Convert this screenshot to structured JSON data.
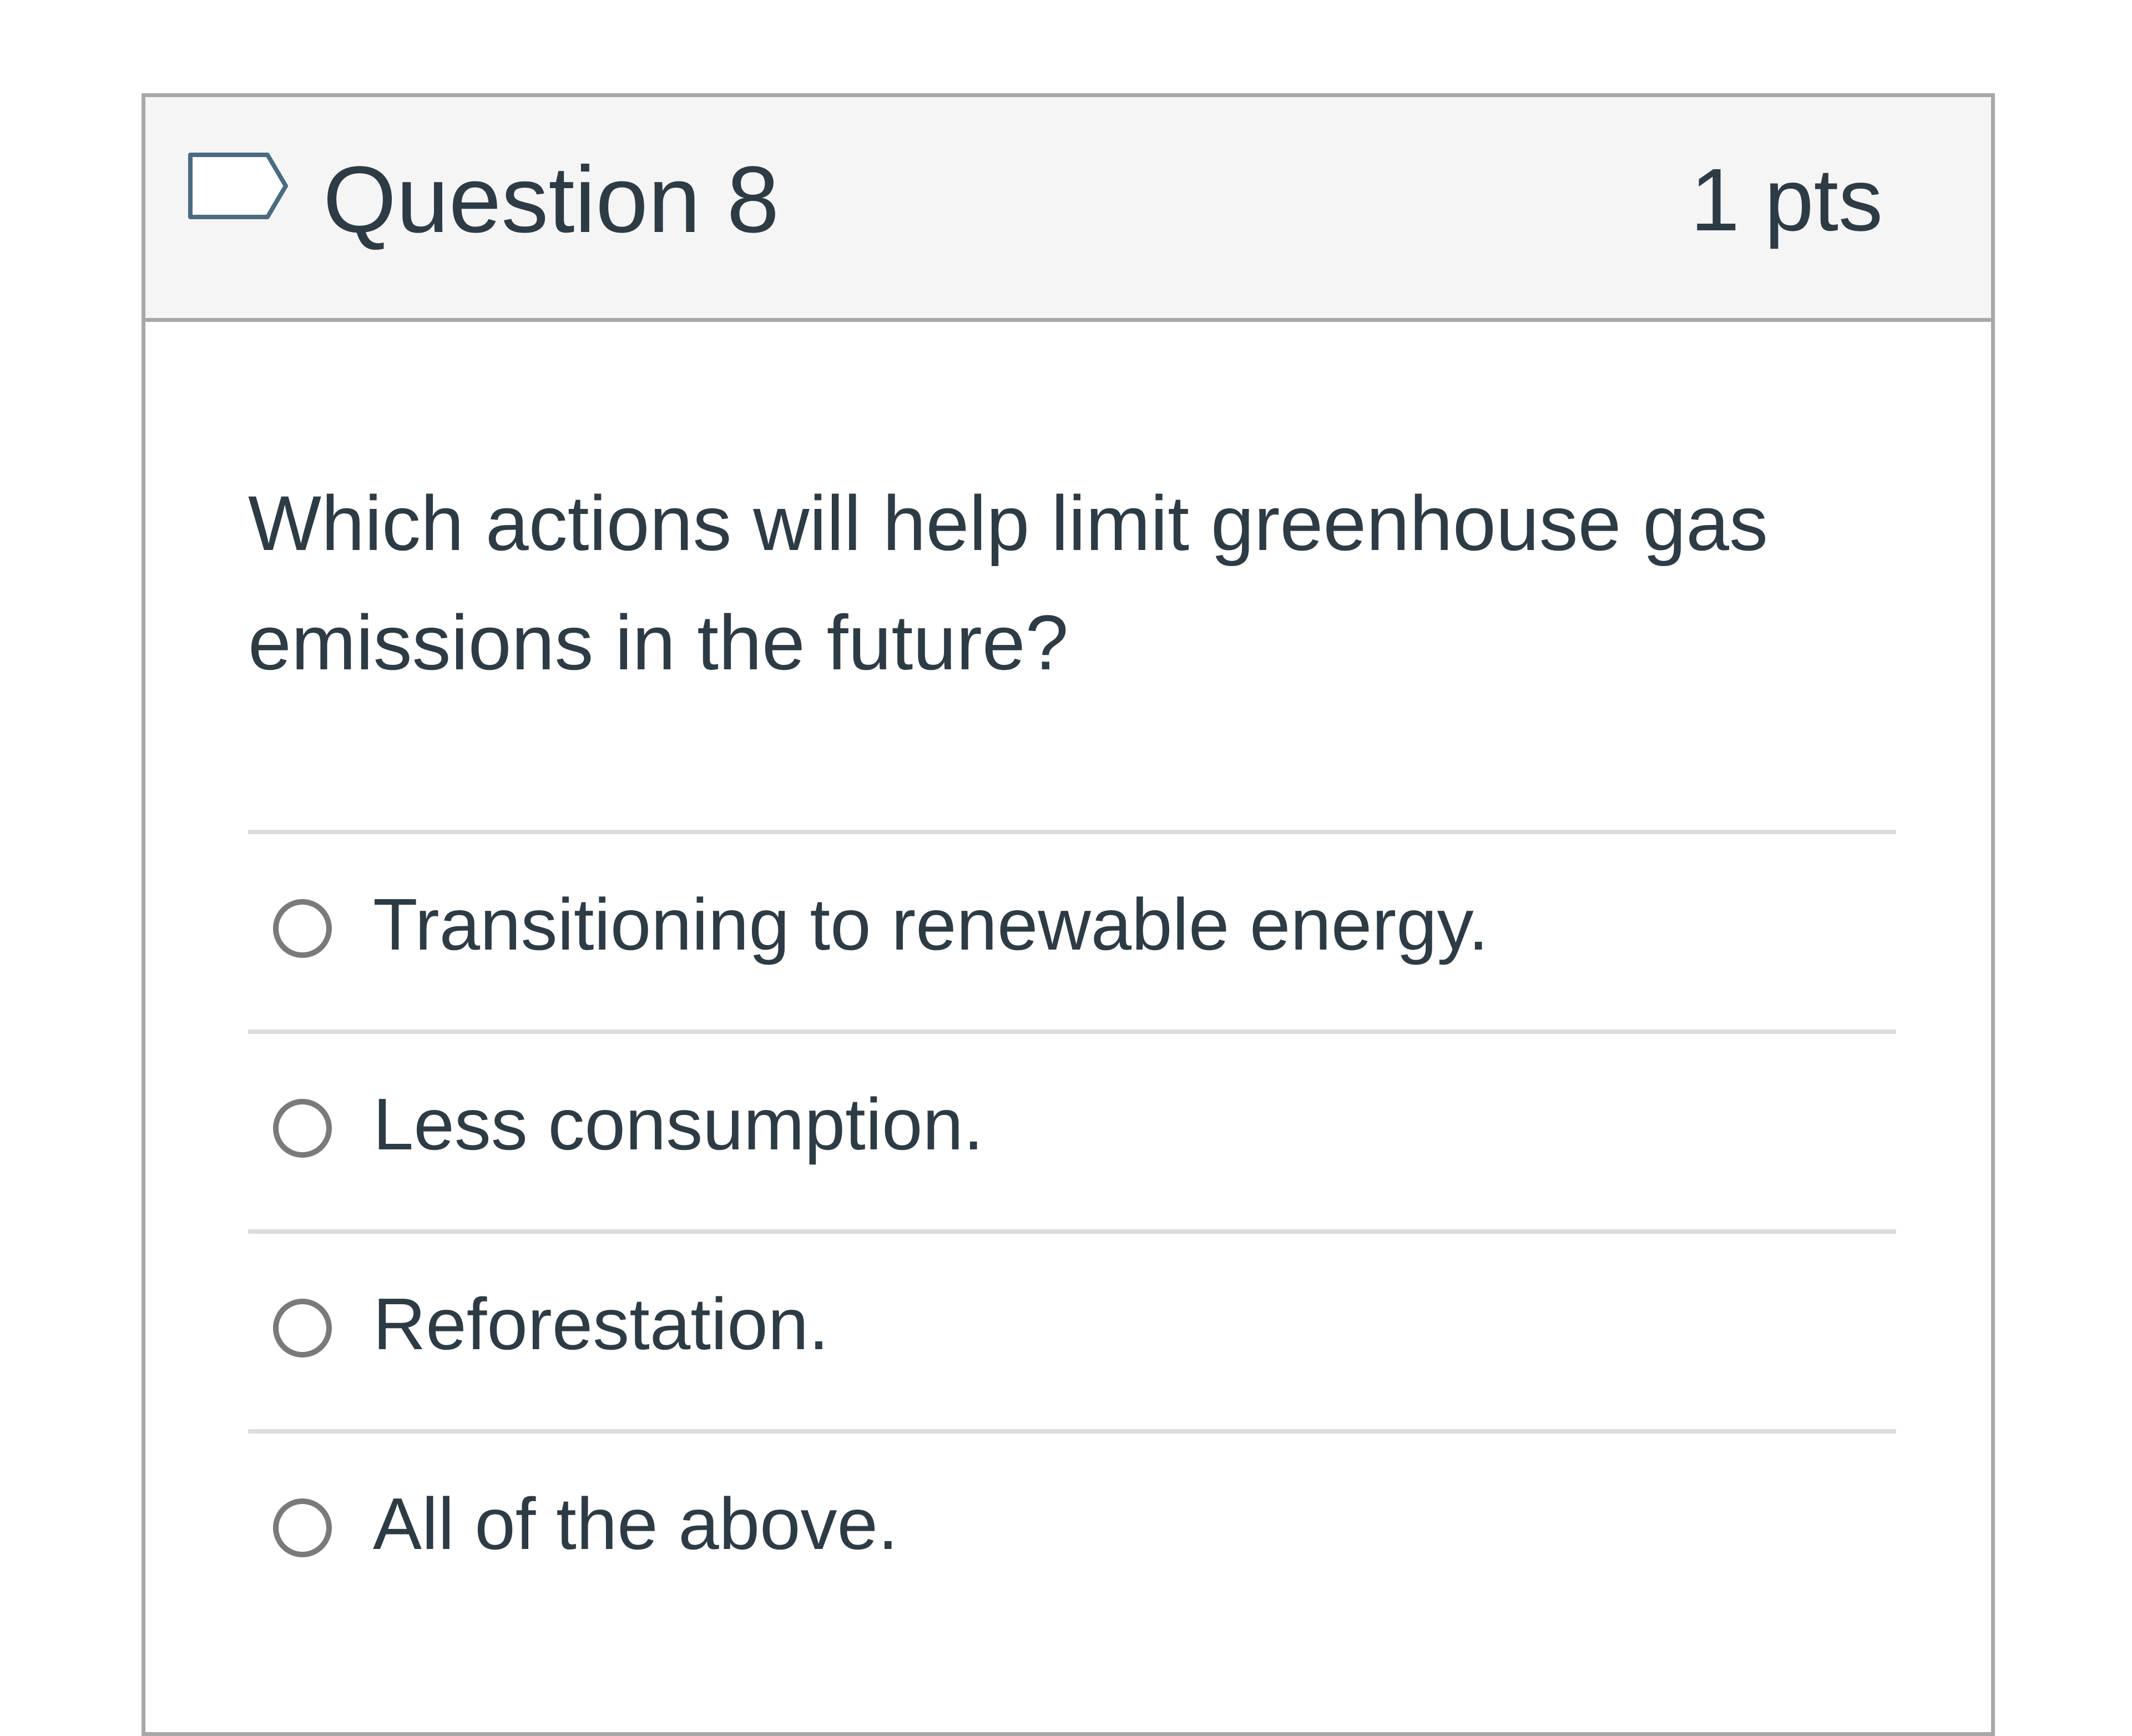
{
  "question": {
    "title": "Question 8",
    "points": "1 pts",
    "flag_icon": "bookmark-flag-icon",
    "text": "Which actions will help limit greenhouse gas emissions in the future?"
  },
  "answers": [
    {
      "label": "Transitioning to renewable energy.",
      "selected": false
    },
    {
      "label": "Less consumption.",
      "selected": false
    },
    {
      "label": "Reforestation.",
      "selected": false
    },
    {
      "label": "All of the above.",
      "selected": false
    }
  ],
  "colors": {
    "header_background": "#f5f5f5",
    "border": "#a8a8a8",
    "text": "#2d3b45",
    "divider": "#dcdcdc",
    "radio_border": "#7a7a7a"
  }
}
